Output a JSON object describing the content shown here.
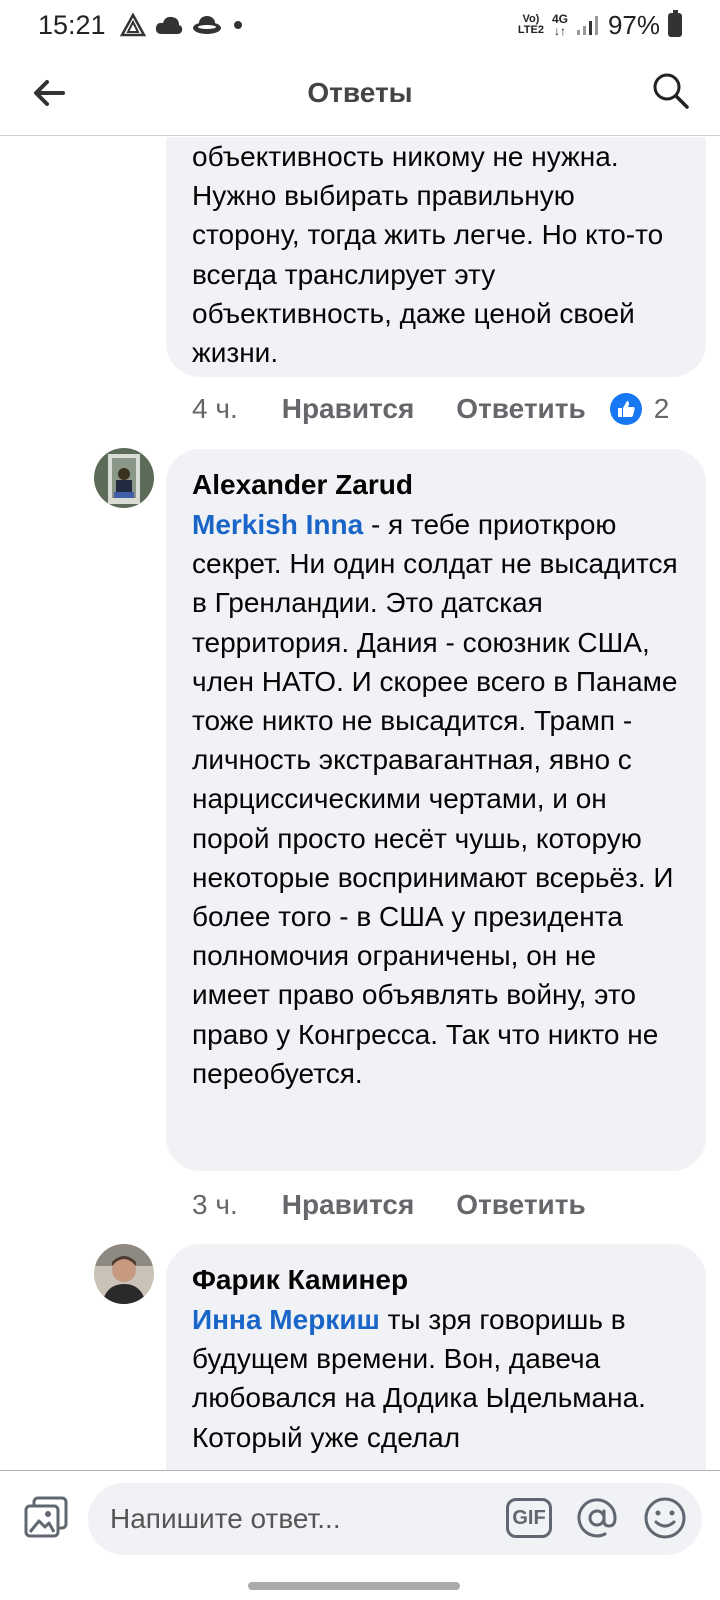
{
  "status_bar": {
    "time": "15:21",
    "network_top": "Vo)",
    "network_bottom": "LTE2",
    "signal_type": "4G",
    "battery": "97%",
    "icons": [
      "triangle-alert-icon",
      "cloud-icon",
      "hat-icon",
      "dot-icon",
      "signal-icon",
      "battery-icon"
    ]
  },
  "header": {
    "title": "Ответы",
    "back_icon": "arrow-left-icon",
    "search_icon": "search-icon"
  },
  "comments": [
    {
      "author": "",
      "mention": "",
      "text": "объективность никому не нужна. Нужно выбирать правильную сторону, тогда жить легче. Но кто-то всегда транслирует эту объективность, даже ценой своей жизни.",
      "time": "4 ч.",
      "like_label": "Нравится",
      "reply_label": "Ответить",
      "reaction_count": "2"
    },
    {
      "author": "Alexander Zarud",
      "mention": "Merkish Inna",
      "text": " - я тебе приоткрою секрет. Ни один солдат не высадится в Гренландии. Это датская территория. Дания - союзник США, член НАТО. И скорее всего в Панаме тоже никто не высадится. Трамп - личность экстравагантная, явно с нарциссическими чертами, и он порой просто несёт чушь, которую некоторые воспринимают всерьёз. И более того - в США у президента полномочия ограничены, он не имеет право объявлять войну, это право у Конгресса. Так что никто не переобуется.",
      "time": "3 ч.",
      "like_label": "Нравится",
      "reply_label": "Ответить"
    },
    {
      "author": "Фарик Каминер",
      "mention": "Инна Меркиш",
      "text": " ты зря говоришь в будущем времени. Вон, давеча любовался на Додика Ыдельмана. Который уже сделал"
    }
  ],
  "composer": {
    "placeholder": "Напишите ответ...",
    "gif_label": "GIF",
    "photo_icon": "photo-icon",
    "mention_icon": "at-icon",
    "emoji_icon": "emoji-icon"
  },
  "colors": {
    "mention": "#1a65c8",
    "bubble": "#f0f2f5",
    "like_badge": "#1877f2",
    "secondary_text": "#65676b"
  }
}
